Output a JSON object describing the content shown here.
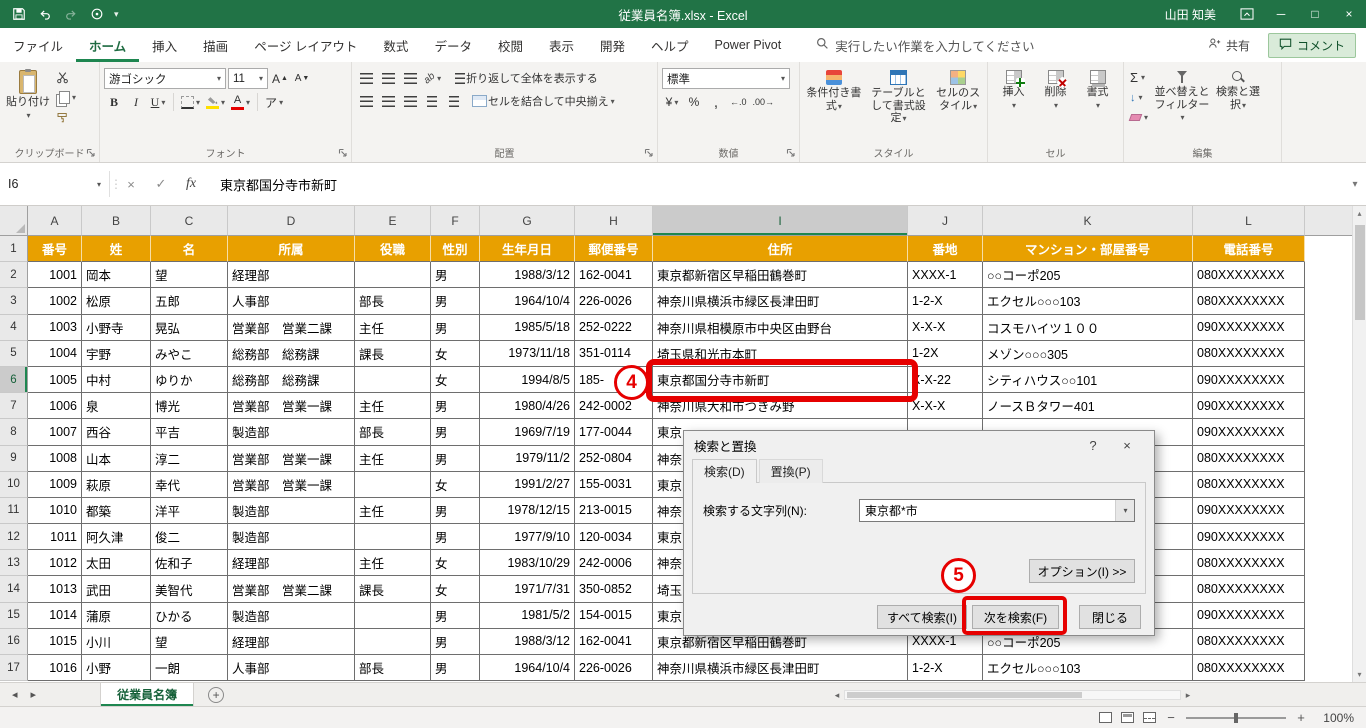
{
  "colors": {
    "excel_green": "#217346",
    "table_header_fill": "#E8A000",
    "annotation_red": "#E60000"
  },
  "icons": {
    "chevron_down": "▾",
    "chevron_up": "▴",
    "tri_left": "◂",
    "tri_right": "▸",
    "close": "×",
    "minimize": "─",
    "maximize": "□",
    "help": "?",
    "cancel_x": "×",
    "enter_check": "✓",
    "fx": "fx",
    "ellipsis_v": "⋮",
    "sigma": "Σ",
    "percent": "%",
    "comma": ",",
    "currency": "¥",
    "bold": "B",
    "italic": "I",
    "underline": "U",
    "font_up": "A",
    "font_down": "A",
    "phonetic": "ア",
    "fill_down_arrow": "↓",
    "increase_decimal": "←.0",
    "decrease_decimal": ".00→",
    "plus": "+",
    "minus": "−",
    "font_color_letter": "A"
  },
  "title_bar": {
    "title": "従業員名簿.xlsx  -  Excel",
    "user_name": "山田 知美"
  },
  "ribbon_tabs": {
    "items": [
      "ファイル",
      "ホーム",
      "挿入",
      "描画",
      "ページ レイアウト",
      "数式",
      "データ",
      "校閲",
      "表示",
      "開発",
      "ヘルプ",
      "Power Pivot"
    ],
    "active": "ホーム",
    "tell_me": "実行したい作業を入力してください",
    "share_label": "共有",
    "comments_label": "コメント"
  },
  "ribbon": {
    "groups": [
      "クリップボード",
      "フォント",
      "配置",
      "数値",
      "スタイル",
      "セル",
      "編集"
    ],
    "paste_label": "貼り付け",
    "font_name": "游ゴシック",
    "font_size": "11",
    "wrap_text_label": "折り返して全体を表示する",
    "merge_label": "セルを結合して中央揃え",
    "number_format": "標準",
    "cond_format_label": "条件付き書式",
    "format_table_label": "テーブルとして書式設定",
    "cell_styles_label": "セルのスタイル",
    "insert_label": "挿入",
    "delete_label": "削除",
    "format_label": "書式",
    "sort_filter_label": "並べ替えとフィルター",
    "find_select_label": "検索と選択"
  },
  "formula_bar": {
    "name_box": "I6",
    "value": "東京都国分寺市新町"
  },
  "sheet": {
    "columns": [
      "A",
      "B",
      "C",
      "D",
      "E",
      "F",
      "G",
      "H",
      "I",
      "J",
      "K",
      "L"
    ],
    "header_labels": [
      "番号",
      "姓",
      "名",
      "所属",
      "役職",
      "性別",
      "生年月日",
      "郵便番号",
      "住所",
      "番地",
      "マンション・部屋番号",
      "電話番号"
    ],
    "rows": [
      {
        "num": "1001",
        "sei": "岡本",
        "mei": "望",
        "dept": "経理部",
        "title": "",
        "gender": "男",
        "birth": "1988/3/12",
        "zip": "162-0041",
        "addr": "東京都新宿区早稲田鶴巻町",
        "banchi": "XXXX-1",
        "bldg": "○○コーポ205",
        "tel": "080XXXXXXXX"
      },
      {
        "num": "1002",
        "sei": "松原",
        "mei": "五郎",
        "dept": "人事部",
        "title": "部長",
        "gender": "男",
        "birth": "1964/10/4",
        "zip": "226-0026",
        "addr": "神奈川県横浜市緑区長津田町",
        "banchi": "1-2-X",
        "bldg": "エクセル○○○103",
        "tel": "080XXXXXXXX"
      },
      {
        "num": "1003",
        "sei": "小野寺",
        "mei": "晃弘",
        "dept": "営業部　営業二課",
        "title": "主任",
        "gender": "男",
        "birth": "1985/5/18",
        "zip": "252-0222",
        "addr": "神奈川県相模原市中央区由野台",
        "banchi": "X-X-X",
        "bldg": "コスモハイツ１００",
        "tel": "090XXXXXXXX"
      },
      {
        "num": "1004",
        "sei": "宇野",
        "mei": "みやこ",
        "dept": "総務部　総務課",
        "title": "課長",
        "gender": "女",
        "birth": "1973/11/18",
        "zip": "351-0114",
        "addr": "埼玉県和光市本町",
        "banchi": "1-2X",
        "bldg": "メゾン○○○305",
        "tel": "080XXXXXXXX"
      },
      {
        "num": "1005",
        "sei": "中村",
        "mei": "ゆりか",
        "dept": "総務部　総務課",
        "title": "",
        "gender": "女",
        "birth": "1994/8/5",
        "zip": "185-",
        "addr": "東京都国分寺市新町",
        "banchi": "X-X-22",
        "bldg": "シティハウス○○101",
        "tel": "090XXXXXXXX"
      },
      {
        "num": "1006",
        "sei": "泉",
        "mei": "博光",
        "dept": "営業部　営業一課",
        "title": "主任",
        "gender": "男",
        "birth": "1980/4/26",
        "zip": "242-0002",
        "addr": "神奈川県大和市つきみ野",
        "banchi": "X-X-X",
        "bldg": "ノースＢタワー401",
        "tel": "090XXXXXXXX"
      },
      {
        "num": "1007",
        "sei": "西谷",
        "mei": "平吉",
        "dept": "製造部",
        "title": "部長",
        "gender": "男",
        "birth": "1969/7/19",
        "zip": "177-0044",
        "addr": "東京",
        "banchi": "",
        "bldg": "",
        "tel": "090XXXXXXXX"
      },
      {
        "num": "1008",
        "sei": "山本",
        "mei": "淳二",
        "dept": "営業部　営業一課",
        "title": "主任",
        "gender": "男",
        "birth": "1979/11/2",
        "zip": "252-0804",
        "addr": "神奈",
        "banchi": "",
        "bldg": "",
        "tel": "080XXXXXXXX"
      },
      {
        "num": "1009",
        "sei": "萩原",
        "mei": "幸代",
        "dept": "営業部　営業一課",
        "title": "",
        "gender": "女",
        "birth": "1991/2/27",
        "zip": "155-0031",
        "addr": "東京",
        "banchi": "",
        "bldg": "",
        "tel": "080XXXXXXXX"
      },
      {
        "num": "1010",
        "sei": "都築",
        "mei": "洋平",
        "dept": "製造部",
        "title": "主任",
        "gender": "男",
        "birth": "1978/12/15",
        "zip": "213-0015",
        "addr": "神奈",
        "banchi": "",
        "bldg": "",
        "tel": "090XXXXXXXX"
      },
      {
        "num": "1011",
        "sei": "阿久津",
        "mei": "俊二",
        "dept": "製造部",
        "title": "",
        "gender": "男",
        "birth": "1977/9/10",
        "zip": "120-0034",
        "addr": "東京",
        "banchi": "",
        "bldg": "",
        "tel": "090XXXXXXXX"
      },
      {
        "num": "1012",
        "sei": "太田",
        "mei": "佐和子",
        "dept": "経理部",
        "title": "主任",
        "gender": "女",
        "birth": "1983/10/29",
        "zip": "242-0006",
        "addr": "神奈",
        "banchi": "",
        "bldg": "",
        "tel": "080XXXXXXXX"
      },
      {
        "num": "1013",
        "sei": "武田",
        "mei": "美智代",
        "dept": "営業部　営業二課",
        "title": "課長",
        "gender": "女",
        "birth": "1971/7/31",
        "zip": "350-0852",
        "addr": "埼玉",
        "banchi": "",
        "bldg": "",
        "tel": "080XXXXXXXX"
      },
      {
        "num": "1014",
        "sei": "蒲原",
        "mei": "ひかる",
        "dept": "製造部",
        "title": "",
        "gender": "男",
        "birth": "1981/5/2",
        "zip": "154-0015",
        "addr": "東京",
        "banchi": "",
        "bldg": "",
        "tel": "090XXXXXXXX"
      },
      {
        "num": "1015",
        "sei": "小川",
        "mei": "望",
        "dept": "経理部",
        "title": "",
        "gender": "男",
        "birth": "1988/3/12",
        "zip": "162-0041",
        "addr": "東京都新宿区早稲田鶴巻町",
        "banchi": "XXXX-1",
        "bldg": "○○コーポ205",
        "tel": "080XXXXXXXX"
      },
      {
        "num": "1016",
        "sei": "小野",
        "mei": "一朗",
        "dept": "人事部",
        "title": "部長",
        "gender": "男",
        "birth": "1964/10/4",
        "zip": "226-0026",
        "addr": "神奈川県横浜市緑区長津田町",
        "banchi": "1-2-X",
        "bldg": "エクセル○○○103",
        "tel": "080XXXXXXXX"
      }
    ]
  },
  "dialog": {
    "title": "検索と置換",
    "tab_find": "検索(D)",
    "tab_replace": "置換(P)",
    "field_label": "検索する文字列(N):",
    "field_value": "東京都*市",
    "options_label": "オプション(I) >>",
    "find_all_label": "すべて検索(I)",
    "find_next_label": "次を検索(F)",
    "close_label": "閉じる"
  },
  "annotations": {
    "step4": "4",
    "step5": "5"
  },
  "sheet_tabs": {
    "active": "従業員名簿"
  },
  "status_bar": {
    "zoom": "100%"
  }
}
